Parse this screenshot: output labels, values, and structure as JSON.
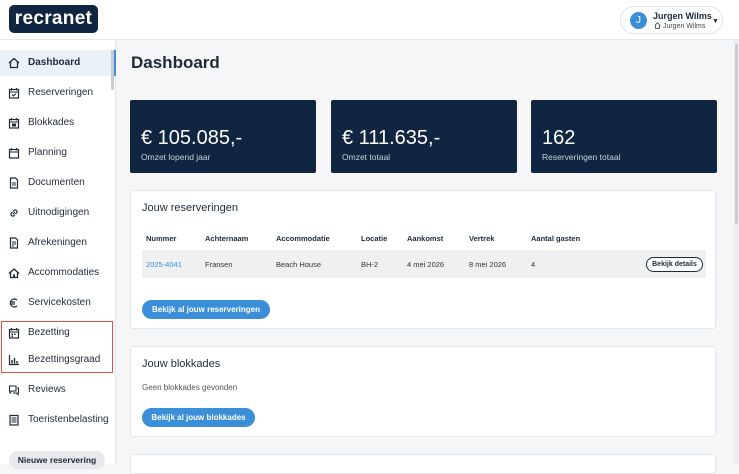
{
  "brand": {
    "logo_text": "recranet",
    "accent": "#3a8fd8",
    "navy": "#0f2540"
  },
  "user": {
    "initial": "J",
    "name": "Jurgen Wilms",
    "subtitle": "Jurgen Wilms"
  },
  "sidebar": {
    "items": [
      {
        "label": "Dashboard",
        "icon": "home-icon",
        "active": true
      },
      {
        "label": "Reserveringen",
        "icon": "calendar-check-icon"
      },
      {
        "label": "Blokkades",
        "icon": "calendar-block-icon"
      },
      {
        "label": "Planning",
        "icon": "calendar-icon"
      },
      {
        "label": "Documenten",
        "icon": "document-icon"
      },
      {
        "label": "Uitnodigingen",
        "icon": "link-icon"
      },
      {
        "label": "Afrekeningen",
        "icon": "invoice-icon"
      },
      {
        "label": "Accommodaties",
        "icon": "house-icon"
      },
      {
        "label": "Servicekosten",
        "icon": "euro-icon"
      },
      {
        "label": "Bezetting",
        "icon": "calendar-grid-icon"
      },
      {
        "label": "Bezettingsgraad",
        "icon": "bar-chart-icon"
      },
      {
        "label": "Reviews",
        "icon": "chat-icon"
      },
      {
        "label": "Toeristenbelasting",
        "icon": "receipt-icon"
      }
    ],
    "new_reservation": "Nieuwe reservering"
  },
  "main": {
    "title": "Dashboard",
    "stats": [
      {
        "value": "€ 105.085,-",
        "caption": "Omzet lopend jaar"
      },
      {
        "value": "€ 111.635,-",
        "caption": "Omzet totaal"
      },
      {
        "value": "162",
        "caption": "Reserveringen totaal"
      }
    ],
    "reservations": {
      "title": "Jouw reserveringen",
      "columns": [
        "Nummer",
        "Achternaam",
        "Accommodatie",
        "Locatie",
        "Aankomst",
        "Vertrek",
        "Aantal gasten"
      ],
      "rows": [
        {
          "nummer": "2025-4041",
          "achternaam": "Fransen",
          "accommodatie": "Beach House",
          "locatie": "BH-2",
          "aankomst": "4 mei 2026",
          "vertrek": "8 mei 2026",
          "gasten": "4",
          "action": "Bekijk details"
        }
      ],
      "button": "Bekijk al jouw reserveringen"
    },
    "blocks": {
      "title": "Jouw blokkades",
      "empty": "Geen blokkades gevonden",
      "button": "Bekijk al jouw blokkades"
    }
  }
}
